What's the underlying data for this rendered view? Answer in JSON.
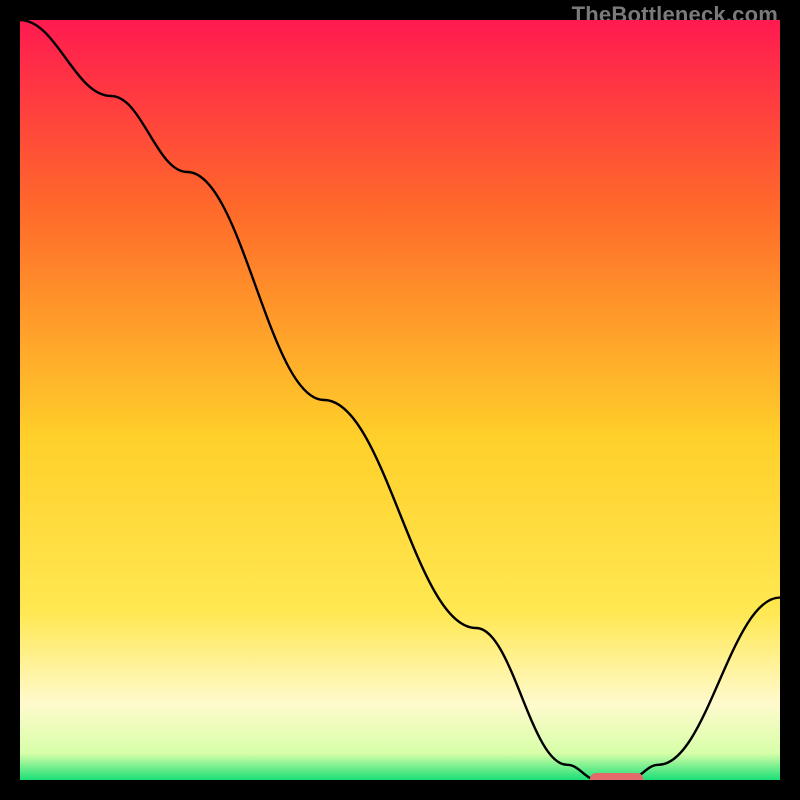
{
  "watermark": "TheBottleneck.com",
  "colors": {
    "gradient_top": "#ff1a50",
    "gradient_mid_upper": "#ff6a2a",
    "gradient_mid": "#ffb926",
    "gradient_mid_lower": "#ffe852",
    "gradient_low": "#fffacd",
    "gradient_green": "#1adf76",
    "line": "#000000",
    "marker": "#e46a6a",
    "frame": "#000000"
  },
  "chart_data": {
    "type": "line",
    "title": "",
    "xlabel": "",
    "ylabel": "",
    "xlim": [
      0,
      100
    ],
    "ylim": [
      0,
      100
    ],
    "grid": false,
    "series": [
      {
        "name": "bottleneck-curve",
        "x": [
          0,
          12,
          22,
          40,
          60,
          72,
          76,
          80,
          84,
          100
        ],
        "y": [
          100,
          90,
          80,
          50,
          20,
          2,
          0,
          0,
          2,
          24
        ]
      }
    ],
    "marker": {
      "name": "optimal-range",
      "x_start": 75,
      "x_end": 82,
      "y": 0
    },
    "background_gradient_stops": [
      {
        "offset": 0.0,
        "color": "#ff1a50"
      },
      {
        "offset": 0.25,
        "color": "#ff6a2a"
      },
      {
        "offset": 0.55,
        "color": "#ffd02a"
      },
      {
        "offset": 0.78,
        "color": "#ffe852"
      },
      {
        "offset": 0.9,
        "color": "#fffacd"
      },
      {
        "offset": 0.965,
        "color": "#d7ffa8"
      },
      {
        "offset": 1.0,
        "color": "#1adf76"
      }
    ]
  }
}
